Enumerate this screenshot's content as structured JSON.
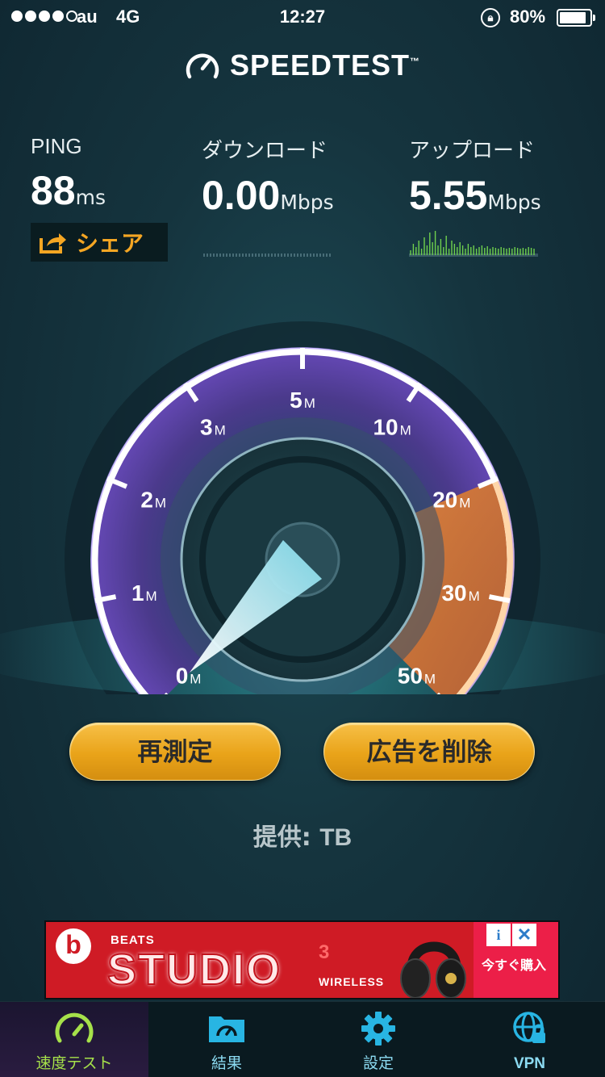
{
  "status_bar": {
    "carrier": "au",
    "network": "4G",
    "time": "12:27",
    "battery": "80%",
    "battery_level": 0.8
  },
  "header": {
    "title": "SPEEDTEST",
    "trademark": "™"
  },
  "stats": {
    "ping": {
      "label": "PING",
      "value": "88",
      "unit": "ms"
    },
    "download": {
      "label": "ダウンロード",
      "value": "0.00",
      "unit": "Mbps"
    },
    "upload": {
      "label": "アップロード",
      "value": "5.55",
      "unit": "Mbps"
    }
  },
  "share": {
    "label": "シェア"
  },
  "gauge": {
    "ticks": [
      {
        "num": "0",
        "unit": "M"
      },
      {
        "num": "1",
        "unit": "M"
      },
      {
        "num": "2",
        "unit": "M"
      },
      {
        "num": "3",
        "unit": "M"
      },
      {
        "num": "5",
        "unit": "M"
      },
      {
        "num": "10",
        "unit": "M"
      },
      {
        "num": "20",
        "unit": "M"
      },
      {
        "num": "30",
        "unit": "M"
      },
      {
        "num": "50",
        "unit": "M"
      }
    ],
    "needle_value": "0"
  },
  "buttons": {
    "retest": "再測定",
    "remove_ads": "広告を削除"
  },
  "provider": {
    "label": "提供:",
    "name": "TB"
  },
  "ad": {
    "brand": "BEATS",
    "product": "STUDIO",
    "version": "3",
    "subtitle": "WIRELESS",
    "cta": "今すぐ購入",
    "info": "i",
    "close": "✕"
  },
  "tabs": [
    {
      "label": "速度テスト",
      "icon": "speedometer-icon",
      "active": true
    },
    {
      "label": "結果",
      "icon": "results-folder-icon",
      "active": false
    },
    {
      "label": "設定",
      "icon": "gear-icon",
      "active": false
    },
    {
      "label": "VPN",
      "icon": "vpn-globe-icon",
      "active": false
    }
  ],
  "colors": {
    "accent_orange": "#f5a623",
    "active_tab": "#a6e14a",
    "tab_label": "#8cdbf2",
    "ad_red": "#cf1b25"
  }
}
